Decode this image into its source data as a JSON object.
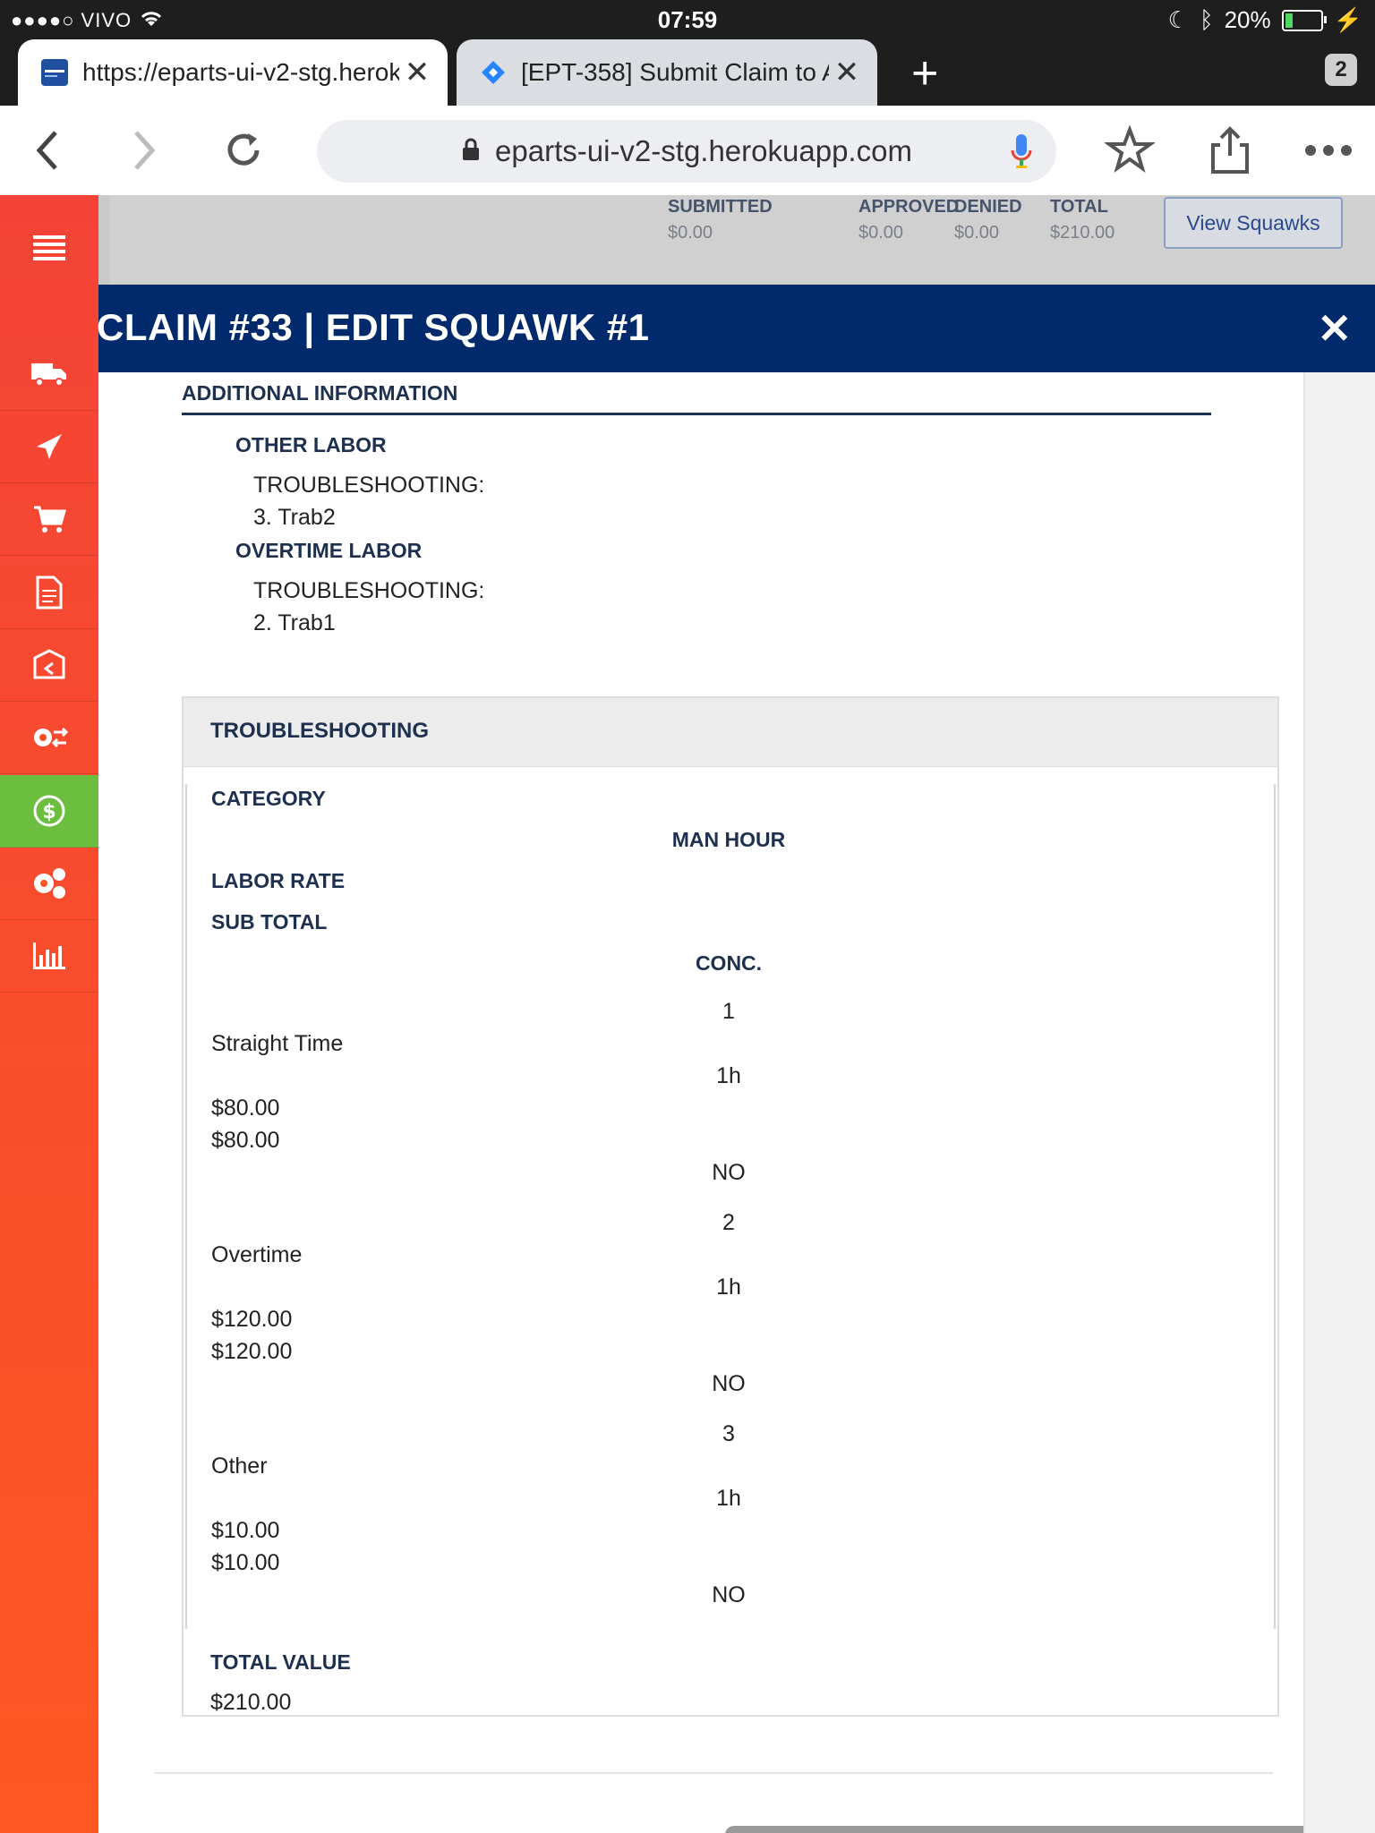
{
  "status_bar": {
    "carrier": "●●●●○ VIVO",
    "time": "07:59",
    "battery": "20%",
    "battery_level": 0.2
  },
  "tabs": [
    {
      "title": "https://eparts-ui-v2-stg.herokuapp.com",
      "favicon_label": "eParts"
    },
    {
      "title": "[EPT-358] Submit Claim to Approval",
      "favicon_icon": "jira-icon"
    }
  ],
  "tab_count": "2",
  "toolbar": {
    "url": "eparts-ui-v2-stg.herokuapp.com"
  },
  "sidebar": {
    "items": [
      {
        "icon": "menu-icon"
      },
      {
        "icon": "truck-icon"
      },
      {
        "icon": "plane-icon"
      },
      {
        "icon": "cart-icon"
      },
      {
        "icon": "document-icon"
      },
      {
        "icon": "box-return-icon"
      },
      {
        "icon": "gear-exchange-icon"
      },
      {
        "icon": "dollar-cycle-icon",
        "active": true
      },
      {
        "icon": "gears-icon"
      },
      {
        "icon": "bar-chart-icon"
      }
    ],
    "active_color": "#6cbf3e",
    "color": "#ff5722"
  },
  "summary": {
    "submitted_label": "SUBMITTED",
    "submitted_value": "$0.00",
    "approved_label": "APPROVED",
    "approved_value": "$0.00",
    "denied_label": "DENIED",
    "denied_value": "$0.00",
    "total_label": "TOTAL",
    "total_value": "$210.00",
    "view_button": "View Squawks"
  },
  "modal": {
    "title": "CLAIM #33 | EDIT SQUAWK #1",
    "header_color": "#002a6b"
  },
  "additional_info": {
    "heading": "ADDITIONAL INFORMATION",
    "other_labor": {
      "heading": "OTHER LABOR",
      "label": "TROUBLESHOOTING:",
      "value": "3. Trab2"
    },
    "overtime_labor": {
      "heading": "OVERTIME LABOR",
      "label": "TROUBLESHOOTING:",
      "value": "2. Trab1"
    }
  },
  "troubleshooting": {
    "heading": "TROUBLESHOOTING",
    "col_category": "CATEGORY",
    "col_man_hour": "MAN HOUR",
    "col_labor_rate": "LABOR RATE",
    "col_sub_total": "SUB TOTAL",
    "col_conc": "CONC.",
    "rows": [
      {
        "index": "1",
        "category": "Straight Time",
        "man_hour": "1h",
        "labor_rate": "$80.00",
        "sub_total": "$80.00",
        "conc": "NO"
      },
      {
        "index": "2",
        "category": "Overtime",
        "man_hour": "1h",
        "labor_rate": "$120.00",
        "sub_total": "$120.00",
        "conc": "NO"
      },
      {
        "index": "3",
        "category": "Other",
        "man_hour": "1h",
        "labor_rate": "$10.00",
        "sub_total": "$10.00",
        "conc": "NO"
      }
    ],
    "total_label": "TOTAL VALUE",
    "total_value": "$210.00"
  }
}
